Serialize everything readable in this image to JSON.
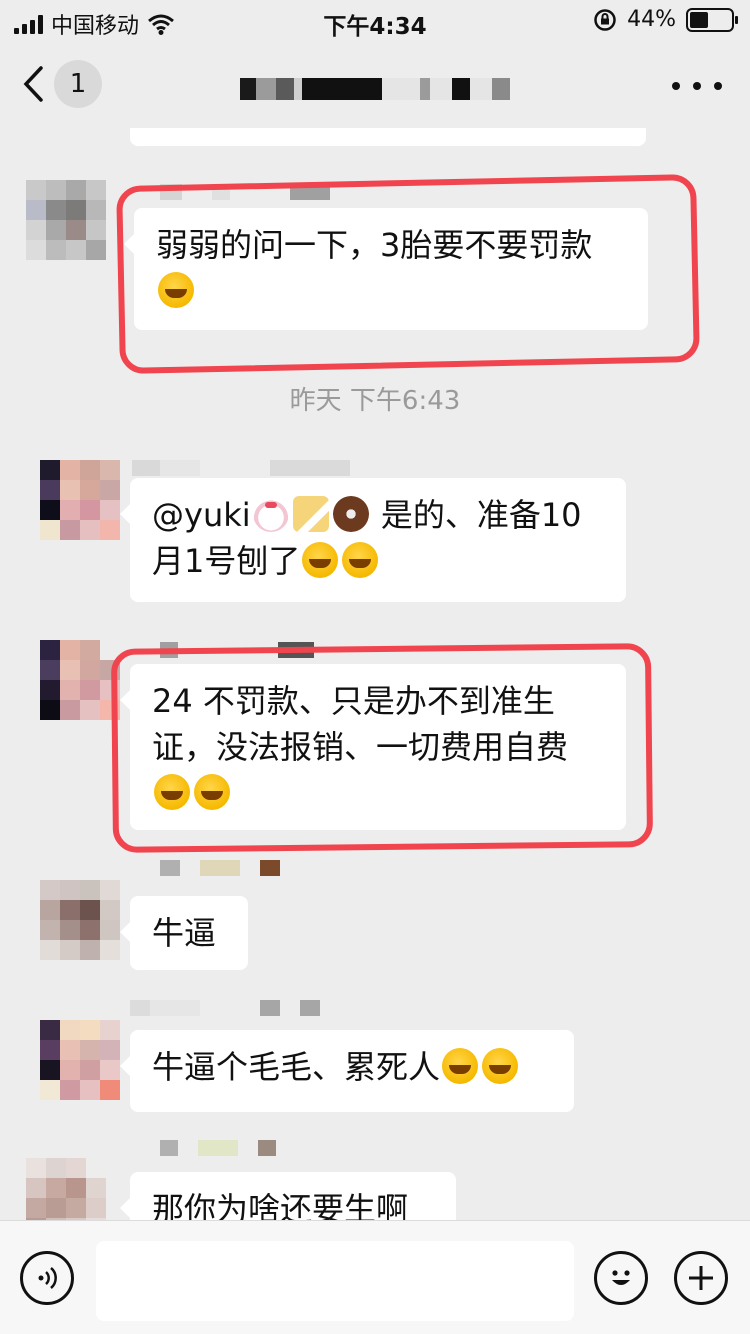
{
  "status_bar": {
    "carrier": "中国移动",
    "time": "下午4:34",
    "battery_pct": "44%",
    "battery_level": 0.44,
    "icons": [
      "signal-icon",
      "wifi-icon",
      "rotation-lock-icon",
      "battery-icon"
    ]
  },
  "nav": {
    "back_icon": "chevron-left-icon",
    "unread_count": "1",
    "more_icon": "more-dots-icon"
  },
  "messages": {
    "m1": {
      "text": "弱弱的问一下，3胎要不要罚款"
    },
    "timestamp": "昨天 下午6:43",
    "m2": {
      "text_a": "@yuki",
      "text_b": " 是的、准备10月1号刨了"
    },
    "m3": {
      "text": "24 不罚款、只是办不到准生证，没法报销、一切费用自费"
    },
    "m4": {
      "text": "牛逼"
    },
    "m5": {
      "text": "牛逼个毛毛、累死人"
    },
    "m6": {
      "text": "那你为啥还要生啊"
    }
  },
  "emoji_names": [
    "face-with-tears-emoji",
    "birthday-cake-emoji",
    "shortcake-emoji",
    "doughnut-emoji"
  ],
  "input_bar": {
    "voice_icon": "voice-icon",
    "emoji_icon": "smiley-icon",
    "add_icon": "plus-circle-icon",
    "placeholder": ""
  },
  "colors": {
    "background": "#ededed",
    "bubble": "#ffffff",
    "annotation_red": "#f0454e"
  }
}
